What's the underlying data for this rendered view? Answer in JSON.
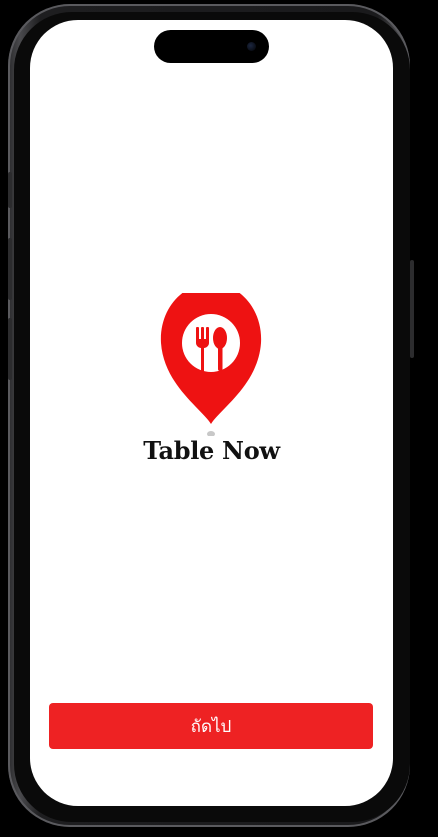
{
  "app": {
    "brand_name": "Table Now",
    "logo_icon": "restaurant-location-pin-icon",
    "accent_color": "#ee2223"
  },
  "footer": {
    "next_label": "ถัดไป"
  }
}
